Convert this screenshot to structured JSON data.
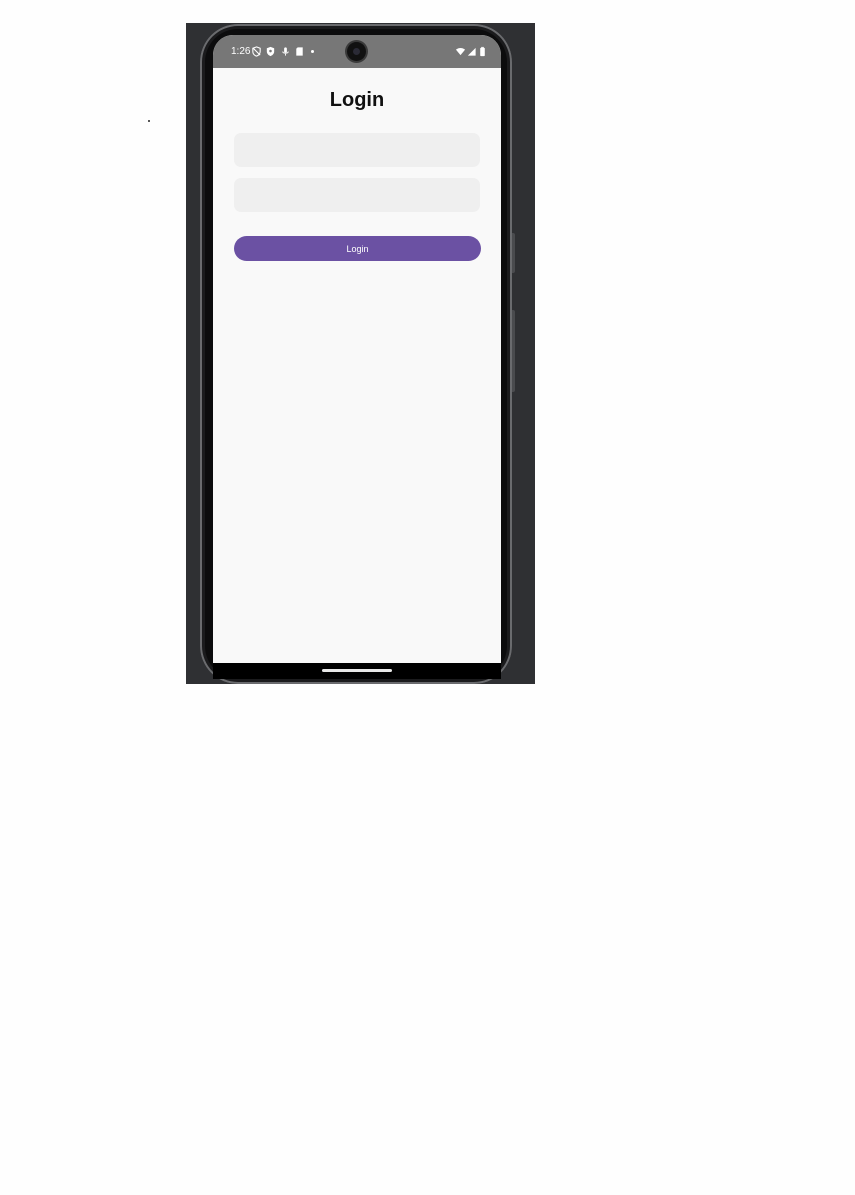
{
  "status_bar": {
    "time": "1:26",
    "left_icons": [
      "shield-off-icon",
      "vpn-shield-icon",
      "mic-icon",
      "sd-card-icon",
      "dot-icon"
    ],
    "right_icons": [
      "wifi-icon",
      "signal-icon",
      "battery-icon"
    ]
  },
  "login_screen": {
    "title": "Login",
    "username_field": {
      "value": "",
      "placeholder": ""
    },
    "password_field": {
      "value": "",
      "placeholder": ""
    },
    "login_button_label": "Login"
  },
  "colors": {
    "accent": "#6b51a3",
    "field_background": "#efefef",
    "screen_background": "#f9f9f9",
    "status_bar": "#777777"
  }
}
